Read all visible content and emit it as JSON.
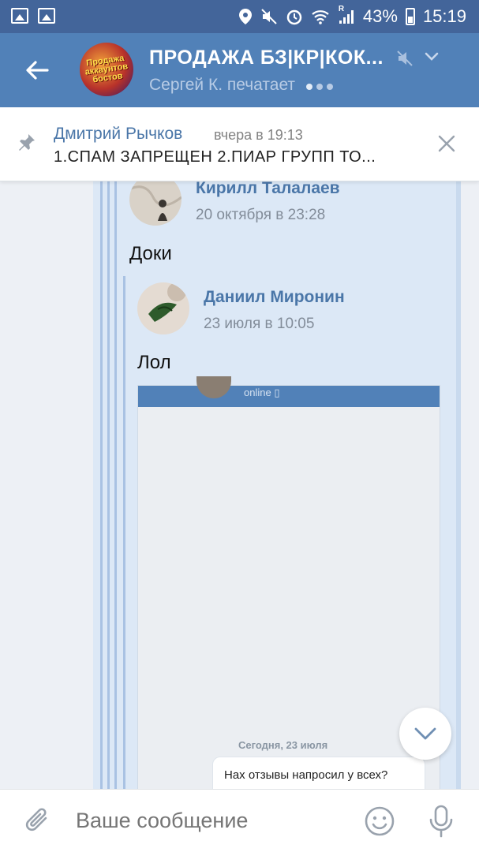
{
  "status_bar": {
    "battery": "43%",
    "time": "15:19",
    "carrier_mark": "R",
    "icons": [
      "image-icon",
      "image-icon",
      "location-icon",
      "mute-icon",
      "alarm-icon",
      "wifi-icon",
      "signal-icon",
      "battery-icon"
    ]
  },
  "header": {
    "title": "ПРОДАЖА БЗ|КР|КОК...",
    "subtitle": "Сергей К. печатает",
    "avatar_text": "Продажа аккаунтов бостов"
  },
  "pinned": {
    "author": "Дмитрий Рычков",
    "time": "вчера в 19:13",
    "text": "1.СПАМ ЗАПРЕЩЕН  2.ПИАР ГРУПП ТО..."
  },
  "messages": [
    {
      "author": "Кирилл Талалаев",
      "date": "20 октября в 23:28",
      "text": "Доки"
    },
    {
      "author": "Даниил Миронин",
      "date": "23 июля в 10:05",
      "text": "Лол"
    }
  ],
  "attachment": {
    "status": "online",
    "day_label": "Сегодня, 23 июля",
    "message": "Нах отзывы напросил у всех?"
  },
  "composer": {
    "placeholder": "Ваше сообщение"
  },
  "colors": {
    "status_bar": "#43659a",
    "header": "#5181b8",
    "accent_name": "#4a76a8",
    "bubble": "#dce8f6"
  }
}
